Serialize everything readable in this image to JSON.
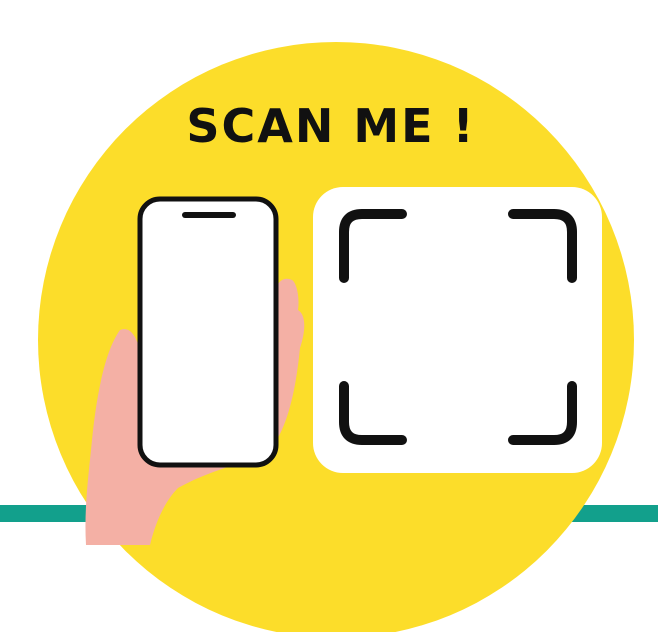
{
  "title": "SCAN ME !",
  "colors": {
    "circle": "#FCDD2A",
    "stripe": "#12A08C",
    "skin": "#F4B0A5",
    "ink": "#111111",
    "panel": "#FFFFFF"
  },
  "icons": {
    "phone": "smartphone-icon",
    "hand": "hand-icon",
    "scan_frame": "qr-scan-frame-icon"
  }
}
